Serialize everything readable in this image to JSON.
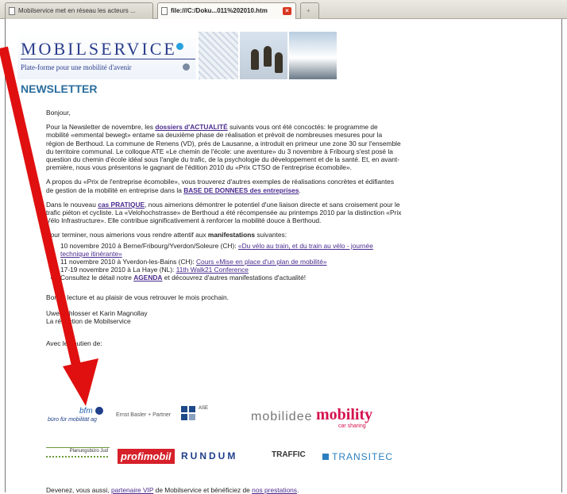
{
  "tabs": [
    {
      "label": "Mobilservice met en réseau les acteurs ..."
    },
    {
      "label": "file:///C:/Doku...011%202010.htm"
    },
    {
      "label": "+"
    }
  ],
  "banner": {
    "title": "MOBILSERVICE",
    "subtitle": "Plate-forme pour une mobilité d'avenir"
  },
  "heading": "NEWSLETTER",
  "greeting": "Bonjour,",
  "p1": {
    "a": "Pour la Newsletter de novembre, les ",
    "link": "dossiers d'ACTUALITÉ",
    "b": " suivants vous ont été concoctés: le programme de mobilité «emmental bewegt» entame sa deuxième phase de réalisation et prévoit de nombreuses mesures pour la région de Berthoud. La commune de Renens (VD), près de Lausanne, a introduit en primeur une zone 30 sur l'ensemble du territoire communal. Le colloque ATE «Le chemin de l'école: une aventure» du 3 novembre à Fribourg s'est posé la question du chemin d'école idéal sous l'angle du trafic, de la psychologie du développement et de la santé. Et, en avant-première, nous vous présentons le gagnant de l'édition 2010 du «Prix CTSO de l'entreprise écomobile»."
  },
  "p2": {
    "a": "A propos du «Prix de l'entreprise écomobile», vous trouverez d'autres exemples de réalisations concrètes et édifiantes de gestion de la mobilité en entreprise dans la ",
    "link": "BASE DE DONNEES des entreprises",
    "b": "."
  },
  "p3": {
    "a": "Dans le nouveau ",
    "link": "cas PRATIQUE",
    "b": ", nous aimerions démontrer le potentiel d'une liaison directe et sans croisement pour le trafic piéton et cycliste. La «Velohochstrasse» de Berthoud a été récompensée au printemps 2010 par la distinction «Prix Vélo Infrastructure». Elle contribue significativement à renforcer la mobilité douce à Berthoud."
  },
  "p4": {
    "a": "Pour terminer, nous aimerions vous rendre attentif aux ",
    "bold": "manifestations",
    "b": " suivantes:"
  },
  "events": [
    {
      "text": "10 novembre 2010 à Berne/Fribourg/Yverdon/Soleure (CH): ",
      "link": "«Du vélo au train, et du train au vélo - journée technique itinérante»"
    },
    {
      "text": "11 novembre 2010 à Yverdon-les-Bains (CH): ",
      "link": "Cours «Mise en place d'un plan de mobilité»"
    },
    {
      "text": "17-19 novembre 2010 à La Haye (NL): ",
      "link": "11th Walk21 Conference"
    },
    {
      "text": "Consultez le détail notre ",
      "link": "AGENDA",
      "after": " et découvrez d'autres manifestations d'actualité!"
    }
  ],
  "closing": "Bonne lecture et au plaisir de vous retrouver le mois prochain.",
  "signature": [
    "Uwe Schlosser et Karin Magnollay",
    "La rédaction de Mobilservice"
  ],
  "sponsor_label": "Avec le soutien de:",
  "sponsors_row1": [
    "bfm",
    "bürо für mobilität ag",
    "Ernst Basler + Partner",
    "ASE",
    "mobilidee",
    "mobility",
    "car sharing"
  ],
  "sponsors_row2": [
    "Planungsbüro Jud",
    "profimobil",
    "RUNDUM",
    "TRAFFIC",
    "TRANSITEC"
  ],
  "footer": {
    "a": "Devenez, vous aussi, ",
    "link1": "partenaire VIP",
    "b": " de Mobilservice et bénéficiez de ",
    "link2": "nos prestations",
    "c": "."
  },
  "colors": {
    "arrow": "#e01010",
    "link": "#4a2b8e",
    "heading": "#2b6e9e",
    "brand": "#2b3d8c"
  }
}
